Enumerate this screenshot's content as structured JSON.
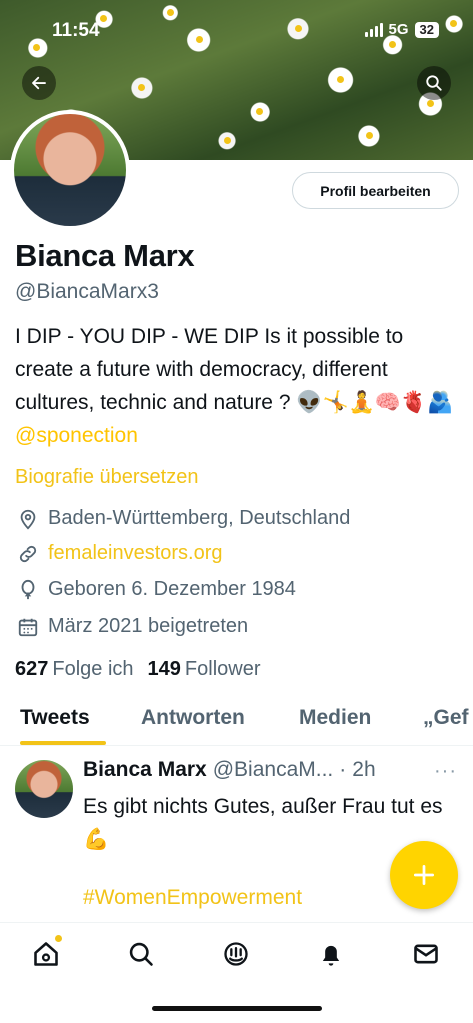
{
  "status": {
    "time": "11:54",
    "network": "5G",
    "battery": "32"
  },
  "profile": {
    "edit_label": "Profil bearbeiten",
    "name": "Bianca Marx",
    "handle": "@BiancaMarx3",
    "bio": "I DIP - YOU DIP - WE DIP Is it possible to create a future with democracy, different cultures, technic and nature ? 👽🤸🧘🧠🫀🫂",
    "bio_mention": "@sponection",
    "translate_label": "Biografie übersetzen",
    "location": "Baden-Württemberg, Deutschland",
    "website": "femaleinvestors.org",
    "birthday": "Geboren 6. Dezember 1984",
    "joined": "März 2021 beigetreten",
    "following_count": "627",
    "following_label": "Folge ich",
    "followers_count": "149",
    "followers_label": "Follower"
  },
  "tabs": [
    {
      "label": "Tweets"
    },
    {
      "label": "Antworten"
    },
    {
      "label": "Medien"
    },
    {
      "label": "„Gef"
    }
  ],
  "tweet": {
    "name": "Bianca Marx",
    "handle": "@BiancaM...",
    "separator": "·",
    "time": "2h",
    "more": "···",
    "text": "Es gibt nichts Gutes, außer Frau tut es 💪",
    "hashtag": "#WomenEmpowerment"
  },
  "icons": {
    "back": "arrow-left-icon",
    "search": "search-icon",
    "compose": "plus-icon",
    "nav": [
      "home-icon",
      "search-icon",
      "spaces-icon",
      "notifications-icon",
      "messages-icon"
    ]
  },
  "colors": {
    "accent": "#f2c318",
    "fab": "#ffd400",
    "muted": "#536471"
  }
}
